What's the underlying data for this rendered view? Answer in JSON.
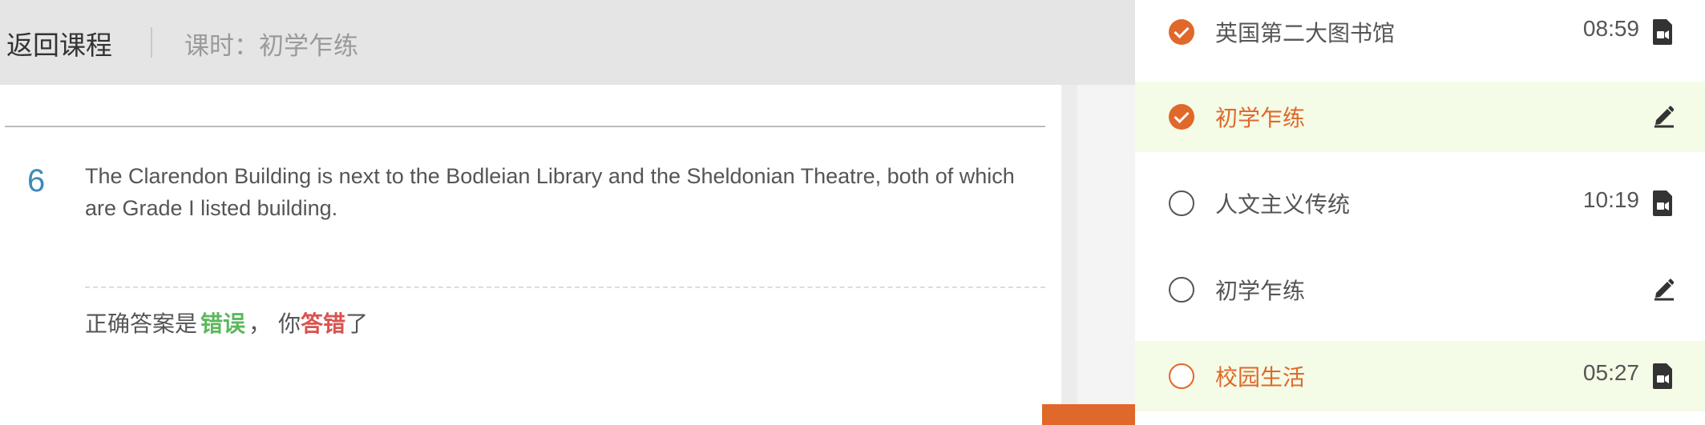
{
  "header": {
    "back_label": "返回课程",
    "lesson_title": "课时：初学乍练"
  },
  "question": {
    "number": "6",
    "text": "The Clarendon Building is next to the Bodleian Library and the Sheldonian Theatre, both of which are Grade I listed building.",
    "answer_prefix": "正确答案是",
    "correct_answer": "错误",
    "separator": "，",
    "you_prefix": "你",
    "result": "答错",
    "result_suffix": "了"
  },
  "lessons": [
    {
      "label": "英国第二大图书馆",
      "duration": "08:59",
      "status": "done",
      "icon": "video-file-icon",
      "active": false
    },
    {
      "label": "初学乍练",
      "duration": "",
      "status": "done",
      "icon": "pencil-icon",
      "active": true
    },
    {
      "label": "人文主义传统",
      "duration": "10:19",
      "status": "todo",
      "icon": "video-file-icon",
      "active": false
    },
    {
      "label": "初学乍练",
      "duration": "",
      "status": "todo",
      "icon": "pencil-icon",
      "active": false
    },
    {
      "label": "校园生活",
      "duration": "05:27",
      "status": "todo-orange",
      "icon": "video-file-icon",
      "active": true
    }
  ],
  "colors": {
    "accent_orange": "#e0682a",
    "correct_green": "#5cb85c",
    "wrong_red": "#d9534f",
    "question_blue": "#3e8ab9",
    "active_row_bg": "#f4fbe6"
  }
}
